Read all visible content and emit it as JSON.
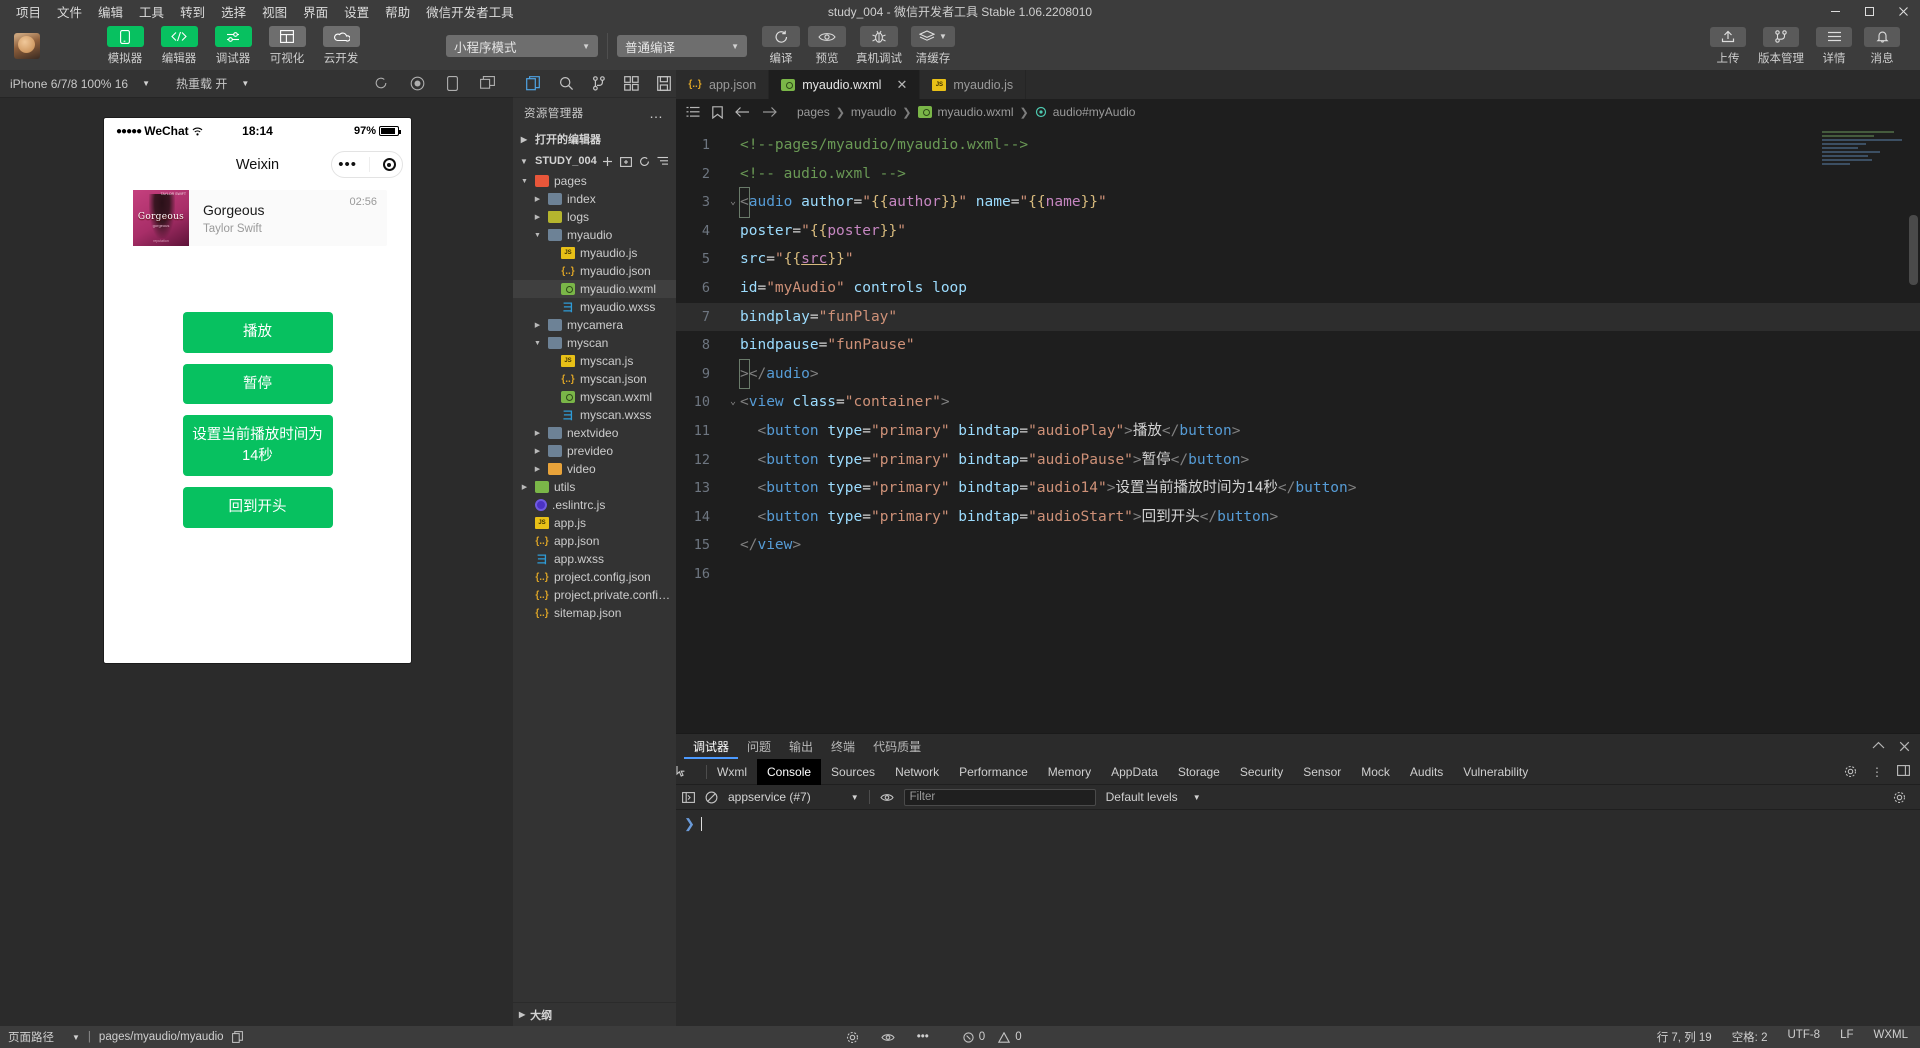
{
  "window": {
    "title": "study_004 - 微信开发者工具 Stable 1.06.2208010",
    "menu": [
      "项目",
      "文件",
      "编辑",
      "工具",
      "转到",
      "选择",
      "视图",
      "界面",
      "设置",
      "帮助",
      "微信开发者工具"
    ],
    "controls": {
      "minimize": "—",
      "maximize": "▢",
      "close": "✕"
    }
  },
  "toolbar": {
    "mode_select": "小程序模式",
    "compile_select": "普通编译",
    "left_buttons": [
      {
        "label": "模拟器",
        "icon": "phone-icon",
        "style": "green"
      },
      {
        "label": "编辑器",
        "icon": "code-icon",
        "style": "green"
      },
      {
        "label": "调试器",
        "icon": "sliders-icon",
        "style": "green"
      },
      {
        "label": "可视化",
        "icon": "layout-icon",
        "style": "gray"
      },
      {
        "label": "云开发",
        "icon": "cloud-icon",
        "style": "gray"
      }
    ],
    "action_buttons": [
      {
        "label": "编译",
        "icon": "refresh-icon"
      },
      {
        "label": "预览",
        "icon": "eye-icon"
      },
      {
        "label": "真机调试",
        "icon": "bug-icon"
      },
      {
        "label": "清缓存",
        "icon": "layers-icon"
      }
    ],
    "right_buttons": [
      {
        "label": "上传",
        "icon": "upload-icon"
      },
      {
        "label": "版本管理",
        "icon": "branch-icon"
      },
      {
        "label": "详情",
        "icon": "list-icon"
      },
      {
        "label": "消息",
        "icon": "bell-icon"
      }
    ]
  },
  "simulator": {
    "device": "iPhone 6/7/8 100% 16",
    "hotreload": "热重载 开",
    "phone": {
      "carrier": "WeChat",
      "dots": "●●●●●",
      "time": "18:14",
      "battery": "97%",
      "nav_title": "Weixin",
      "audio": {
        "title": "Gorgeous",
        "artist": "Taylor Swift",
        "duration": "02:56",
        "cover_text": "Gorgeous",
        "cover_top": "TAYLOR SWIFT",
        "cover_sub": "gorgeous",
        "cover_bottom": "reputation"
      },
      "buttons": [
        "播放",
        "暂停",
        "设置当前播放时间为14秒",
        "回到开头"
      ]
    }
  },
  "explorer": {
    "title": "资源管理器",
    "more": "…",
    "open_editors": "打开的编辑器",
    "project": "STUDY_004",
    "project_actions": [
      "new-file-icon",
      "new-folder-icon",
      "refresh-icon",
      "collapse-icon"
    ],
    "outline": "大纲",
    "tree": [
      {
        "label": "pages",
        "type": "folder",
        "color": "red",
        "indent": 1,
        "arrow": "open"
      },
      {
        "label": "index",
        "type": "folder",
        "color": "blue",
        "indent": 2,
        "arrow": "closed"
      },
      {
        "label": "logs",
        "type": "folder",
        "color": "olive",
        "indent": 2,
        "arrow": "closed"
      },
      {
        "label": "myaudio",
        "type": "folder",
        "color": "gray",
        "indent": 2,
        "arrow": "open"
      },
      {
        "label": "myaudio.js",
        "type": "js",
        "indent": 3,
        "arrow": "none"
      },
      {
        "label": "myaudio.json",
        "type": "json",
        "indent": 3,
        "arrow": "none"
      },
      {
        "label": "myaudio.wxml",
        "type": "wxml",
        "indent": 3,
        "arrow": "none",
        "selected": true
      },
      {
        "label": "myaudio.wxss",
        "type": "wxss",
        "indent": 3,
        "arrow": "none"
      },
      {
        "label": "mycamera",
        "type": "folder",
        "color": "blue",
        "indent": 2,
        "arrow": "closed"
      },
      {
        "label": "myscan",
        "type": "folder",
        "color": "gray",
        "indent": 2,
        "arrow": "open"
      },
      {
        "label": "myscan.js",
        "type": "js",
        "indent": 3,
        "arrow": "none"
      },
      {
        "label": "myscan.json",
        "type": "json",
        "indent": 3,
        "arrow": "none"
      },
      {
        "label": "myscan.wxml",
        "type": "wxml",
        "indent": 3,
        "arrow": "none"
      },
      {
        "label": "myscan.wxss",
        "type": "wxss",
        "indent": 3,
        "arrow": "none"
      },
      {
        "label": "nextvideo",
        "type": "folder",
        "color": "blue",
        "indent": 2,
        "arrow": "closed"
      },
      {
        "label": "prevideo",
        "type": "folder",
        "color": "blue",
        "indent": 2,
        "arrow": "closed"
      },
      {
        "label": "video",
        "type": "folder",
        "color": "orange",
        "indent": 2,
        "arrow": "closed"
      },
      {
        "label": "utils",
        "type": "folder",
        "color": "green",
        "indent": 1,
        "arrow": "closed"
      },
      {
        "label": ".eslintrc.js",
        "type": "eslint",
        "indent": 1,
        "arrow": "none"
      },
      {
        "label": "app.js",
        "type": "js",
        "indent": 1,
        "arrow": "none"
      },
      {
        "label": "app.json",
        "type": "json",
        "indent": 1,
        "arrow": "none"
      },
      {
        "label": "app.wxss",
        "type": "wxss",
        "indent": 1,
        "arrow": "none"
      },
      {
        "label": "project.config.json",
        "type": "json",
        "indent": 1,
        "arrow": "none"
      },
      {
        "label": "project.private.config...",
        "type": "json",
        "indent": 1,
        "arrow": "none"
      },
      {
        "label": "sitemap.json",
        "type": "json",
        "indent": 1,
        "arrow": "none"
      }
    ]
  },
  "editor": {
    "tabs": [
      {
        "label": "app.json",
        "type": "json",
        "active": false
      },
      {
        "label": "myaudio.wxml",
        "type": "wxml",
        "active": true,
        "close": "✕"
      },
      {
        "label": "myaudio.js",
        "type": "js",
        "active": false
      }
    ],
    "breadcrumb": [
      "pages",
      "myaudio",
      "myaudio.wxml",
      "audio#myAudio"
    ],
    "lines": [
      {
        "num": "1",
        "fold": ""
      },
      {
        "num": "2",
        "fold": ""
      },
      {
        "num": "3",
        "fold": "⌄",
        "highlight_bracket": true
      },
      {
        "num": "4",
        "fold": ""
      },
      {
        "num": "5",
        "fold": ""
      },
      {
        "num": "6",
        "fold": ""
      },
      {
        "num": "7",
        "fold": "",
        "active": true
      },
      {
        "num": "8",
        "fold": ""
      },
      {
        "num": "9",
        "fold": "",
        "highlight_bracket": true
      },
      {
        "num": "10",
        "fold": "⌄"
      },
      {
        "num": "11",
        "fold": ""
      },
      {
        "num": "12",
        "fold": ""
      },
      {
        "num": "13",
        "fold": ""
      },
      {
        "num": "14",
        "fold": ""
      },
      {
        "num": "15",
        "fold": ""
      },
      {
        "num": "16",
        "fold": ""
      }
    ],
    "code_text": {
      "l1": "<!--pages/myaudio/myaudio.wxml-->",
      "l2": "<!-- audio.wxml -->",
      "l3": "<audio author=\"{{author}}\" name=\"{{name}}\"",
      "l4": "poster=\"{{poster}}\"",
      "l5": "src=\"{{src}}\"",
      "l6": "id=\"myAudio\" controls loop",
      "l7": "bindplay=\"funPlay\"",
      "l8": "bindpause=\"funPause\"",
      "l9": "></audio>",
      "l10": "<view class=\"container\">",
      "l11": "<button type=\"primary\" bindtap=\"audioPlay\">播放</button>",
      "l12": "<button type=\"primary\" bindtap=\"audioPause\">暂停</button>",
      "l13": "<button type=\"primary\" bindtap=\"audio14\">设置当前播放时间为14秒</button>",
      "l14": "<button type=\"primary\" bindtap=\"audioStart\">回到开头</button>",
      "l15": "</view>"
    }
  },
  "debugger": {
    "panel_tabs": [
      "调试器",
      "问题",
      "输出",
      "终端",
      "代码质量"
    ],
    "panel_tab_active": "调试器",
    "devtools_tabs": [
      "Wxml",
      "Console",
      "Sources",
      "Network",
      "Performance",
      "Memory",
      "AppData",
      "Storage",
      "Security",
      "Sensor",
      "Mock",
      "Audits",
      "Vulnerability"
    ],
    "devtools_tab_active": "Console",
    "console": {
      "context": "appservice (#7)",
      "filter_placeholder": "Filter",
      "levels": "Default levels",
      "prompt": "❯"
    }
  },
  "statusbar": {
    "path_label": "页面路径",
    "path_value": "pages/myaudio/myaudio",
    "errors": "0",
    "warnings": "0",
    "cursor": "行 7, 列 19",
    "spaces": "空格: 2",
    "encoding": "UTF-8",
    "eol": "LF",
    "language": "WXML"
  },
  "colors": {
    "accent_green": "#07c160",
    "bg_dark": "#2b2b2b",
    "editor_bg": "#1e1e1e",
    "toolbar_bg": "#3c3c3c"
  }
}
